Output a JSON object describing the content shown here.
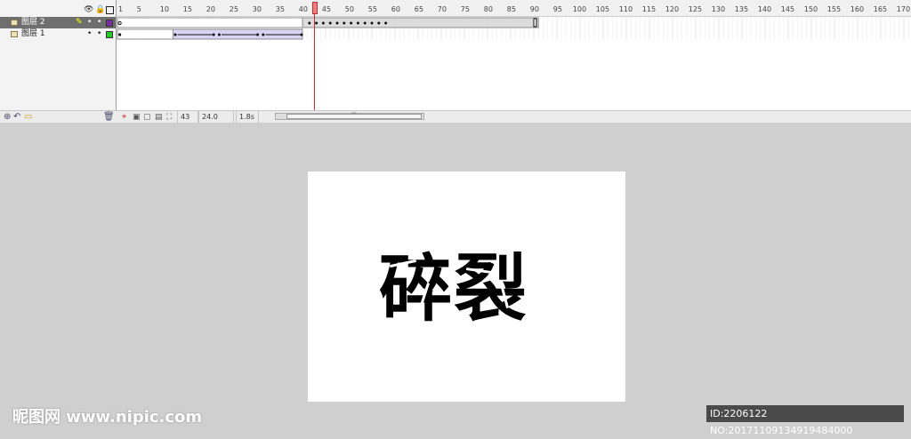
{
  "timeline": {
    "header_icons": {
      "eye": "eye-icon",
      "lock": "lock-icon",
      "outline": "outline-icon"
    },
    "layers": [
      {
        "name": "图层 2",
        "selected": true,
        "outline_color": "#7b2f9c"
      },
      {
        "name": "图层 1",
        "selected": false,
        "outline_color": "#28c828"
      }
    ],
    "ruler_labels": [
      "1",
      "5",
      "10",
      "15",
      "20",
      "25",
      "30",
      "35",
      "40",
      "45",
      "50",
      "55",
      "60",
      "65",
      "70",
      "75",
      "80",
      "85",
      "90",
      "95",
      "100",
      "105",
      "110",
      "115",
      "120",
      "125",
      "130",
      "135",
      "140",
      "145",
      "150",
      "155",
      "160",
      "165",
      "170"
    ],
    "current_frame": "43",
    "frame_rate": "24.0 fps",
    "elapsed_time": "1.8s",
    "scroll_grip": "'''"
  },
  "stage": {
    "text": "碎裂",
    "background": "#ffffff"
  },
  "watermark": {
    "left": "昵图网 www.nipic.com",
    "right": "ID:2206122 NO:20171109134919484000"
  },
  "colors": {
    "panel_bg": "#f3f3f3",
    "workspace_bg": "#cfcfcf",
    "playhead": "#d12a2a",
    "selected_layer": "#6f6f6f"
  }
}
